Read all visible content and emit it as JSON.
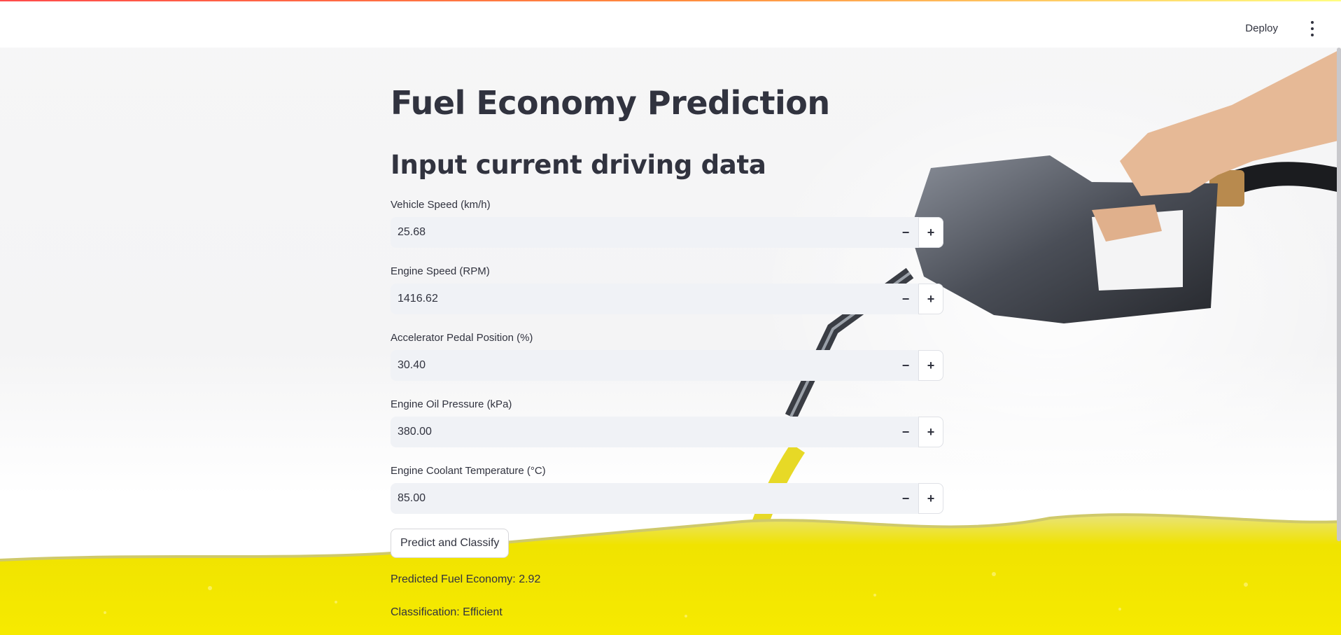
{
  "header": {
    "deploy_label": "Deploy"
  },
  "main": {
    "title": "Fuel Economy Prediction",
    "subtitle": "Input current driving data",
    "fields": [
      {
        "label": "Vehicle Speed (km/h)",
        "value": "25.68"
      },
      {
        "label": "Engine Speed (RPM)",
        "value": "1416.62"
      },
      {
        "label": "Accelerator Pedal Position (%)",
        "value": "30.40"
      },
      {
        "label": "Engine Oil Pressure (kPa)",
        "value": "380.00"
      },
      {
        "label": "Engine Coolant Temperature (°C)",
        "value": "85.00"
      }
    ],
    "predict_button_label": "Predict and Classify",
    "predicted_text": "Predicted Fuel Economy: 2.92",
    "classification_text": "Classification: Efficient"
  },
  "icons": {
    "menu": "vertical-dots-icon",
    "decrement": "minus-icon",
    "increment": "plus-icon"
  },
  "colors": {
    "accent_red": "#ff4b4b",
    "input_bg": "#f0f2f6",
    "text": "#31333f",
    "fuel_yellow": "#f2e400"
  }
}
